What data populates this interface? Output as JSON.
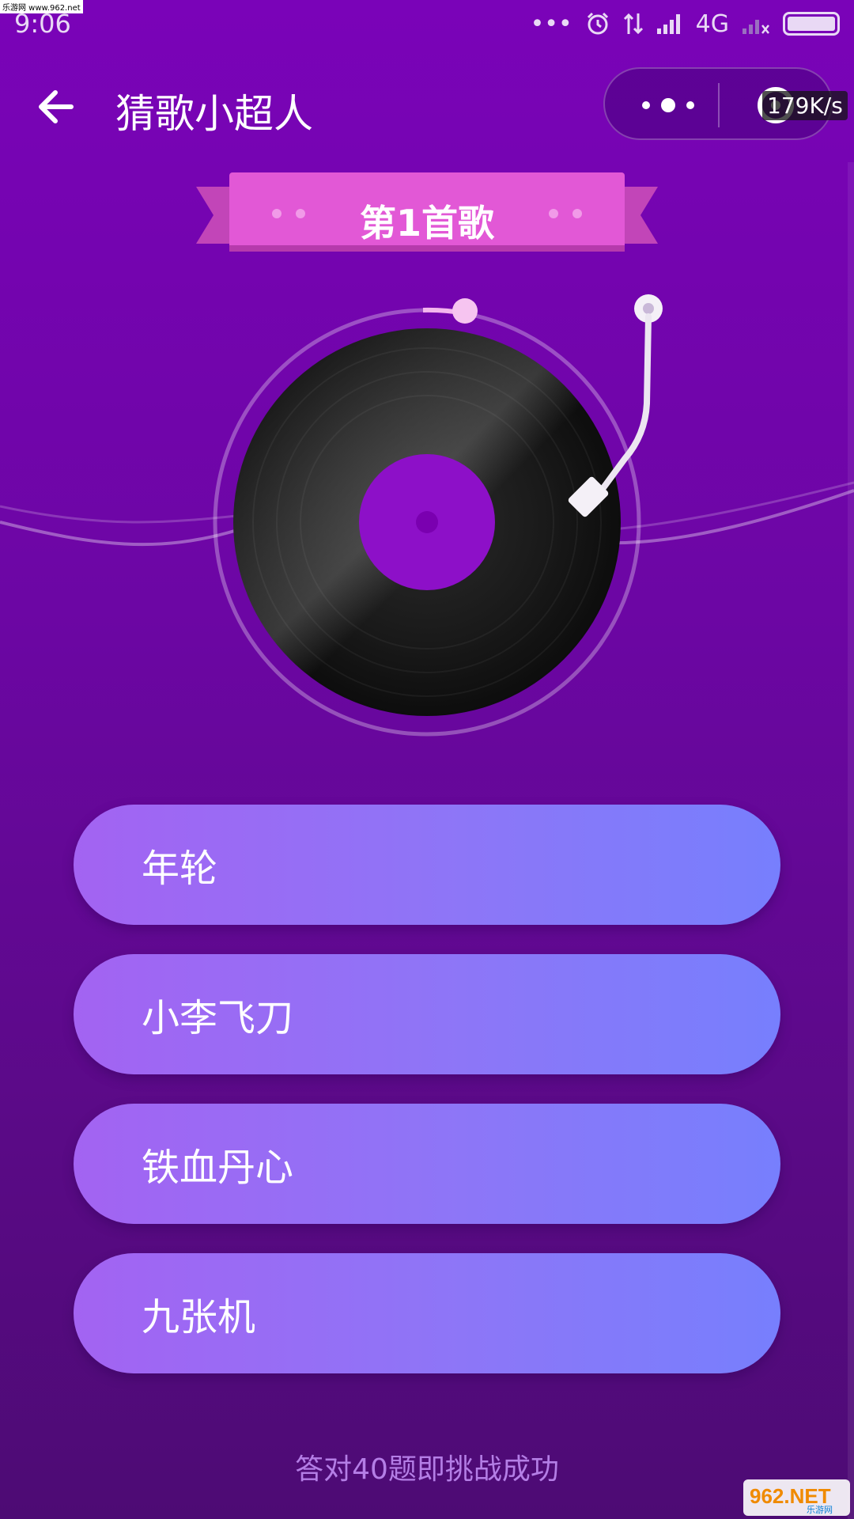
{
  "watermark": "乐游网 www.962.net",
  "status_bar": {
    "time": "9:06",
    "dots": "•••",
    "network": "4G"
  },
  "header": {
    "title": "猜歌小超人",
    "speed": "179K/s"
  },
  "banner": {
    "label": "第1首歌"
  },
  "options": [
    {
      "label": "年轮"
    },
    {
      "label": "小李飞刀"
    },
    {
      "label": "铁血丹心"
    },
    {
      "label": "九张机"
    }
  ],
  "footer": {
    "tip": "答对40题即挑战成功",
    "logo_text": "962.NET",
    "logo_sub": "乐游网"
  },
  "colors": {
    "background": "#7a03b8",
    "banner": "#e258d6",
    "option_start": "#a363f2",
    "option_end": "#777ffd",
    "record_label": "#8d10c8"
  },
  "icons": {
    "back": "arrow-left-icon",
    "more": "more-dots-icon",
    "close_ring": "ring-icon",
    "alarm": "alarm-icon",
    "signal": "signal-icon",
    "battery": "battery-icon"
  }
}
